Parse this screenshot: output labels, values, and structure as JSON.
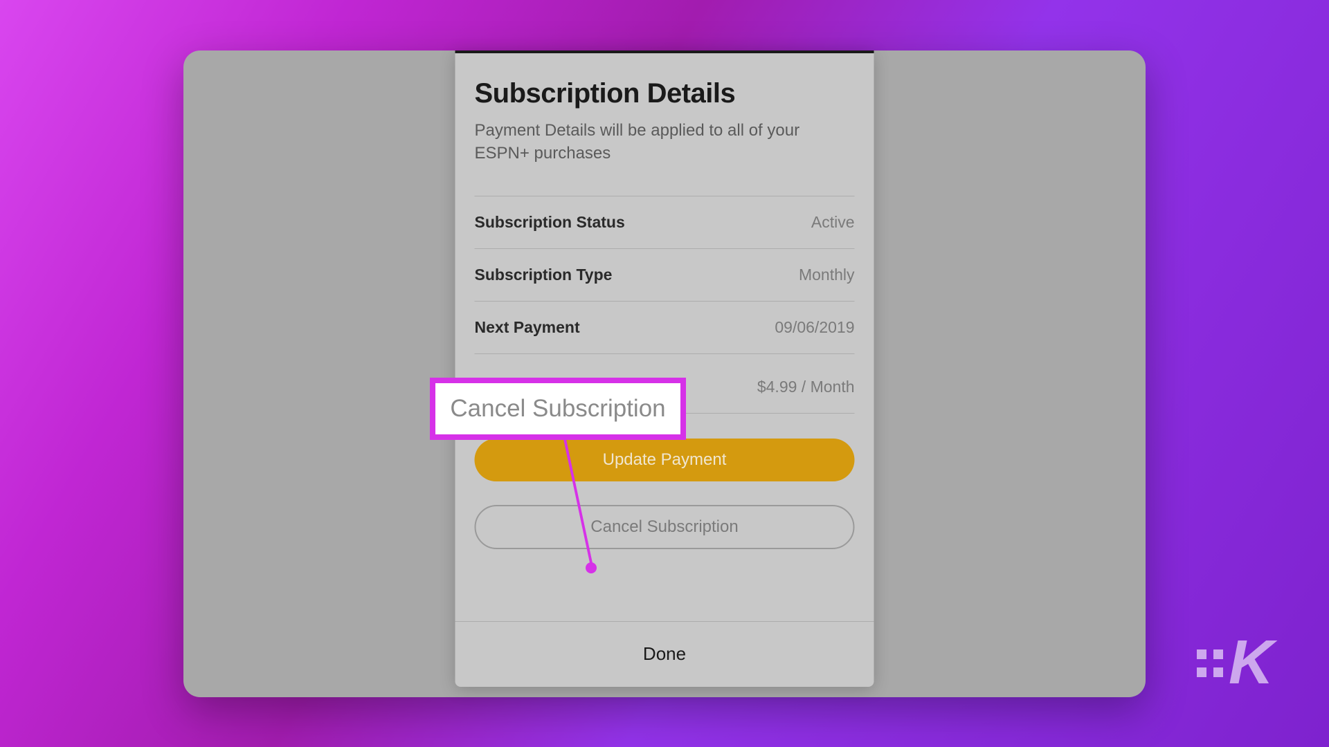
{
  "modal": {
    "title": "Subscription Details",
    "subtitle": "Payment Details will be applied to all of your ESPN+ purchases",
    "rows": {
      "status": {
        "label": "Subscription Status",
        "value": "Active"
      },
      "type": {
        "label": "Subscription Type",
        "value": "Monthly"
      },
      "next": {
        "label": "Next Payment",
        "value": "09/06/2019"
      },
      "price": {
        "value": "$4.99 / Month"
      }
    },
    "buttons": {
      "update": "Update Payment",
      "cancel": "Cancel Subscription",
      "done": "Done"
    }
  },
  "callout": {
    "text": "Cancel Subscription"
  },
  "logo": {
    "letter": "K"
  }
}
